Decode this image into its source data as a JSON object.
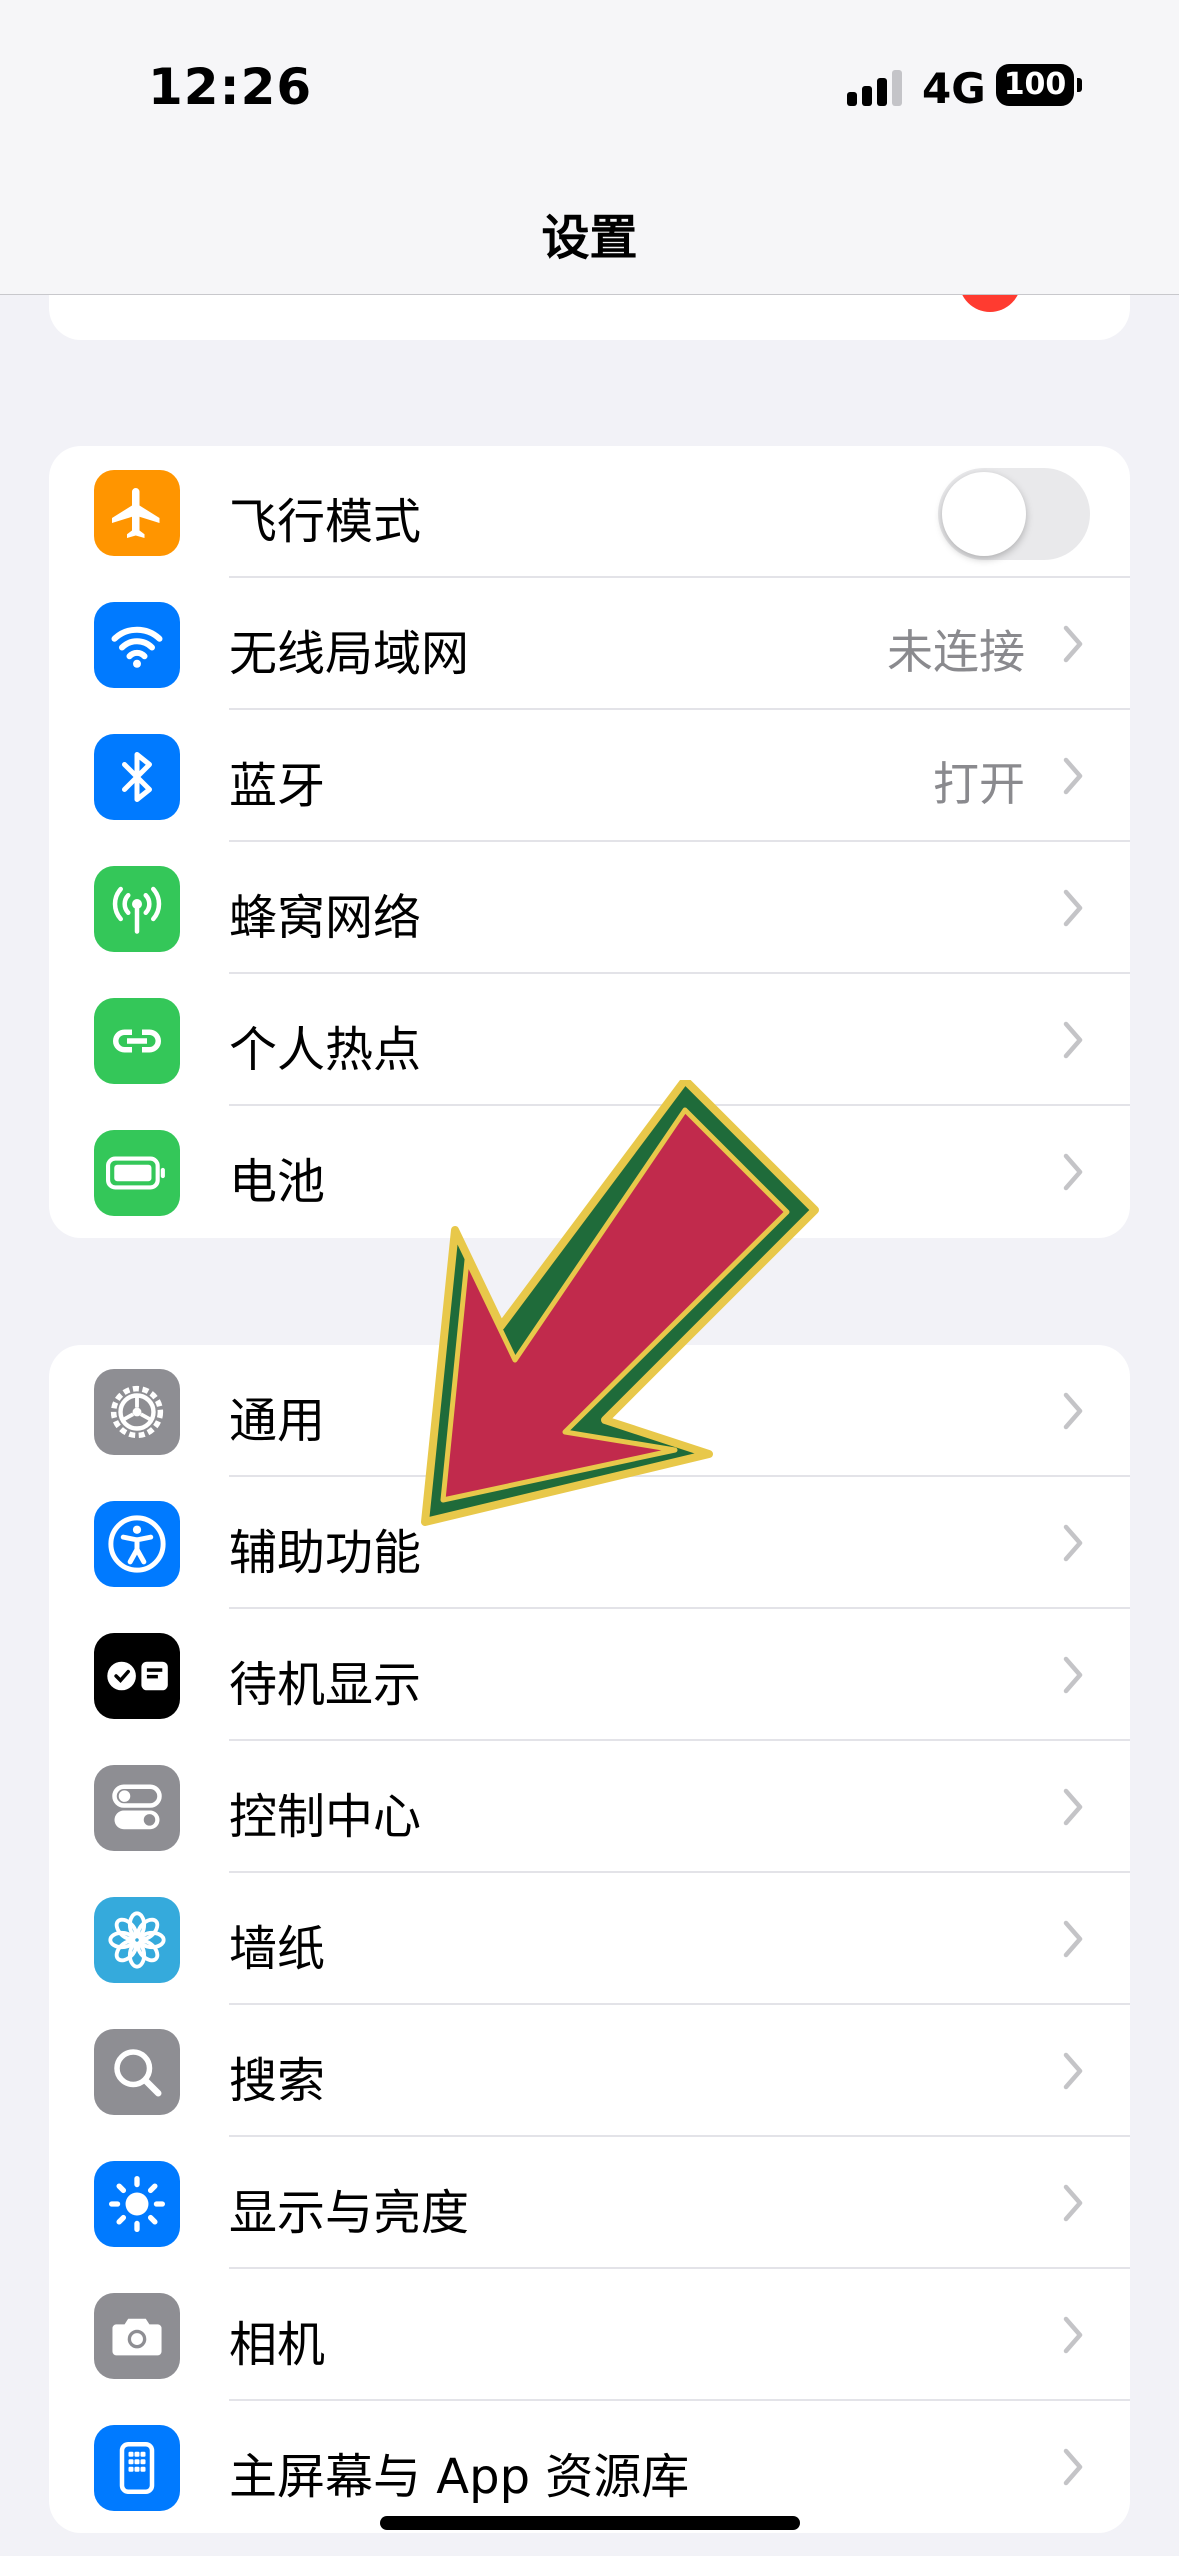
{
  "status_bar": {
    "time": "12:26",
    "network": "4G",
    "battery": "100"
  },
  "nav": {
    "title": "设置"
  },
  "groups": [
    [
      {
        "label": "飞行模式",
        "icon": "airplane-icon",
        "color": "#ff9500",
        "toggle": true
      },
      {
        "label": "无线局域网",
        "icon": "wifi-icon",
        "color": "#007aff",
        "value": "未连接"
      },
      {
        "label": "蓝牙",
        "icon": "bluetooth-icon",
        "color": "#007aff",
        "value": "打开"
      },
      {
        "label": "蜂窝网络",
        "icon": "cellular-icon",
        "color": "#34c759"
      },
      {
        "label": "个人热点",
        "icon": "hotspot-icon",
        "color": "#34c759"
      },
      {
        "label": "电池",
        "icon": "battery-icon",
        "color": "#34c759"
      }
    ],
    [
      {
        "label": "通用",
        "icon": "gear-icon",
        "color": "#8e8e93"
      },
      {
        "label": "辅助功能",
        "icon": "accessibility-icon",
        "color": "#007aff"
      },
      {
        "label": "待机显示",
        "icon": "standby-icon",
        "color": "#000000"
      },
      {
        "label": "控制中心",
        "icon": "control-center-icon",
        "color": "#8e8e93"
      },
      {
        "label": "墙纸",
        "icon": "wallpaper-icon",
        "color": "#35aadc"
      },
      {
        "label": "搜索",
        "icon": "search-icon",
        "color": "#8e8e93"
      },
      {
        "label": "显示与亮度",
        "icon": "brightness-icon",
        "color": "#007aff"
      },
      {
        "label": "相机",
        "icon": "camera-icon",
        "color": "#8e8e93"
      },
      {
        "label": "主屏幕与 App 资源库",
        "icon": "home-screen-icon",
        "color": "#007aff"
      }
    ]
  ]
}
